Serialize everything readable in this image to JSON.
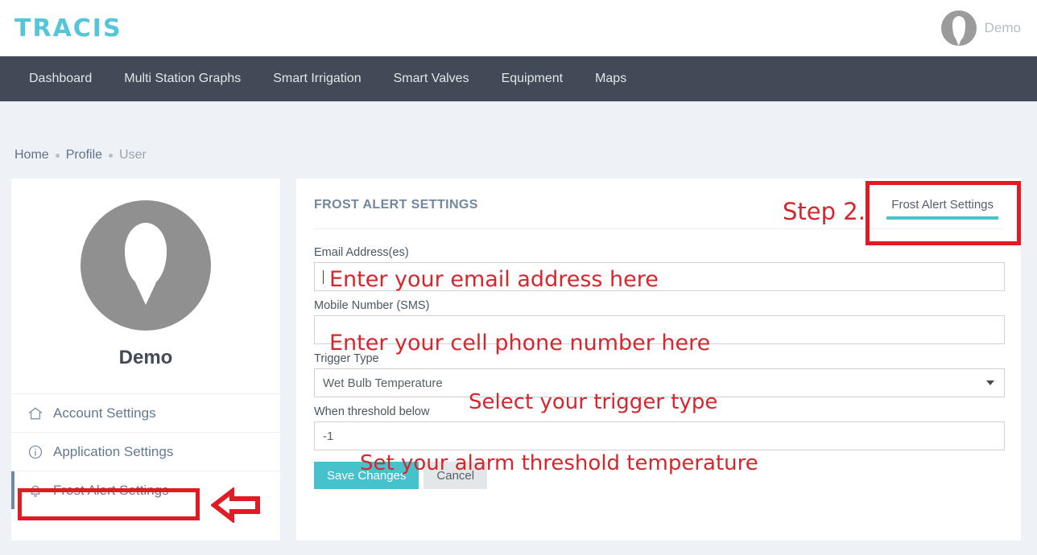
{
  "header": {
    "logo": "TRACIS",
    "user_name": "Demo",
    "avatar_icon": "user-silhouette-icon"
  },
  "nav": {
    "items": [
      {
        "label": "Dashboard"
      },
      {
        "label": "Multi Station Graphs"
      },
      {
        "label": "Smart Irrigation"
      },
      {
        "label": "Smart Valves"
      },
      {
        "label": "Equipment"
      },
      {
        "label": "Maps"
      }
    ]
  },
  "breadcrumb": {
    "items": [
      {
        "label": "Home",
        "current": false
      },
      {
        "label": "Profile",
        "current": false
      },
      {
        "label": "User",
        "current": true
      }
    ]
  },
  "sidebar": {
    "profile_name": "Demo",
    "avatar_icon": "user-silhouette-icon",
    "items": [
      {
        "label": "Account Settings",
        "icon": "home-icon"
      },
      {
        "label": "Application Settings",
        "icon": "info-circle-icon"
      },
      {
        "label": "Frost Alert Settings",
        "icon": "bell-icon"
      }
    ]
  },
  "main": {
    "title": "FROST ALERT SETTINGS",
    "tabs": [
      {
        "label": "Frost Alert Settings",
        "active": true
      }
    ],
    "fields": {
      "email": {
        "label": "Email Address(es)",
        "value": "",
        "placeholder": ""
      },
      "mobile": {
        "label": "Mobile Number (SMS)",
        "value": "",
        "placeholder": ""
      },
      "trigger": {
        "label": "Trigger Type",
        "value": "Wet Bulb Temperature"
      },
      "threshold": {
        "label": "When threshold below",
        "value": "-1"
      }
    },
    "buttons": {
      "save": "Save Changes",
      "cancel": "Cancel"
    }
  },
  "annotations": {
    "step": "Step 2.",
    "email_hint": "Enter your email address here",
    "mobile_hint": "Enter your cell phone number here",
    "trigger_hint": "Select your trigger type",
    "threshold_hint": "Set your alarm threshold temperature"
  },
  "colors": {
    "brand_cyan": "#55c5d8",
    "nav_bg": "#414a56",
    "accent_teal": "#4cc3c9",
    "annotation_red": "#d4272d",
    "page_bg": "#eef1f5"
  }
}
